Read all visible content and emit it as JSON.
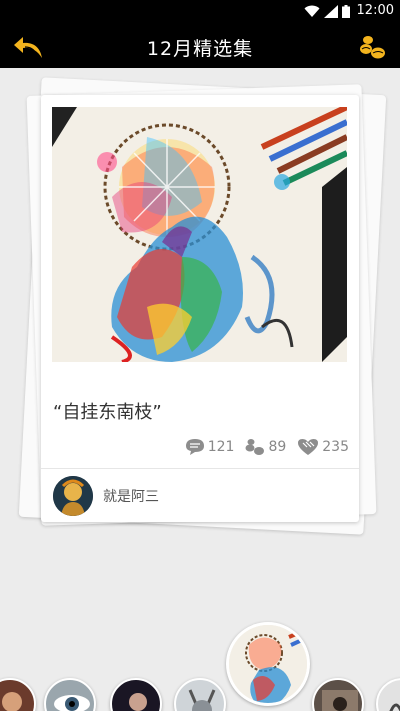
{
  "status_bar": {
    "time": "12:00"
  },
  "header": {
    "title": "12月精选集",
    "back_icon": "back-arrow-icon",
    "coins_icon": "coins-icon"
  },
  "card": {
    "quote": "“自挂东南枝”",
    "comments": "121",
    "coins": "89",
    "likes": "235",
    "author": "就是阿三"
  },
  "carousel": {
    "items": [
      "thumb-1",
      "thumb-2",
      "thumb-3",
      "thumb-4",
      "thumb-5",
      "thumb-6",
      "thumb-7"
    ],
    "selected_index": 4
  },
  "colors": {
    "bar": "#000000",
    "accent": "#f3b41e",
    "background": "#ececec"
  }
}
